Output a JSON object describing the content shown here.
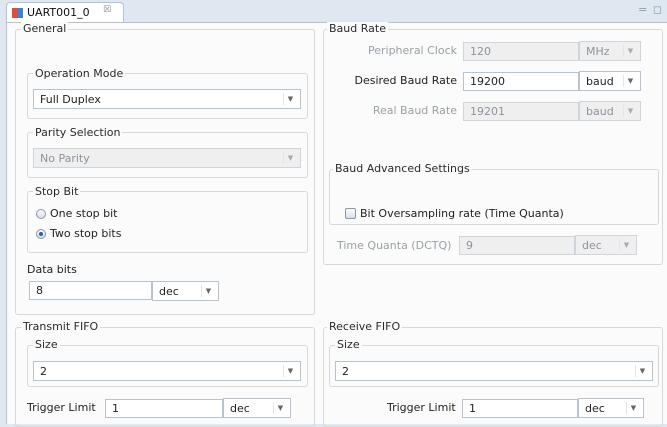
{
  "tab": {
    "title": "UART001_0",
    "close_glyph": "☒",
    "controls": "= ◻"
  },
  "general": {
    "title": "General",
    "operation_mode": {
      "title": "Operation Mode",
      "value": "Full Duplex"
    },
    "parity": {
      "title": "Parity Selection",
      "value": "No Parity"
    },
    "stop_bit": {
      "title": "Stop Bit",
      "option1": "One stop bit",
      "option2": "Two stop bits",
      "selected": "Two stop bits"
    },
    "data_bits": {
      "label": "Data bits",
      "value": "8",
      "format": "dec"
    }
  },
  "baud": {
    "title": "Baud Rate",
    "peripheral_clock": {
      "label": "Peripheral Clock",
      "value": "120",
      "unit": "MHz"
    },
    "desired": {
      "label": "Desired Baud Rate",
      "value": "19200",
      "unit": "baud"
    },
    "real": {
      "label": "Real Baud Rate",
      "value": "19201",
      "unit": "baud"
    },
    "advanced": {
      "title": "Baud Advanced Settings",
      "oversampling_label": "Bit Oversampling rate (Time Quanta)",
      "oversampling_checked": false,
      "time_quanta": {
        "label": "Time Quanta (DCTQ)",
        "value": "9",
        "format": "dec"
      }
    }
  },
  "transmit_fifo": {
    "title": "Transmit FIFO",
    "size_title": "Size",
    "size_value": "2",
    "trigger_label": "Trigger Limit",
    "trigger_value": "1",
    "trigger_format": "dec"
  },
  "receive_fifo": {
    "title": "Receive FIFO",
    "size_title": "Size",
    "size_value": "2",
    "trigger_label": "Trigger Limit",
    "trigger_value": "1",
    "trigger_format": "dec"
  }
}
